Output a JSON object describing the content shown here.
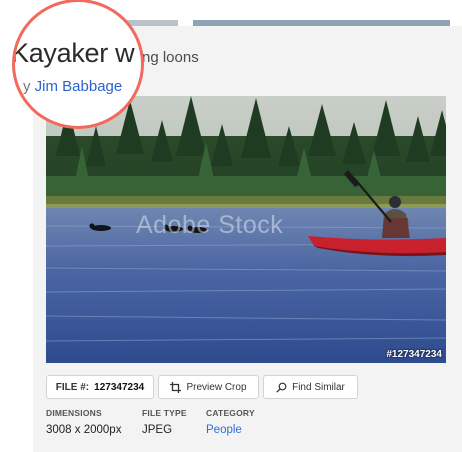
{
  "asset": {
    "title_zoomed": "Kayaker w",
    "title_rest": "ng loons",
    "byline_prefix": "y",
    "author": "Jim Babbage",
    "stock_id_overlay": "#127347234",
    "watermark": "Adobe Stock"
  },
  "actions": {
    "file_label": "FILE #:",
    "file_number": "127347234",
    "preview_crop": "Preview Crop",
    "find_similar": "Find Similar"
  },
  "details": {
    "dimensions_label": "DIMENSIONS",
    "dimensions_value": "3008 x 2000px",
    "filetype_label": "FILE TYPE",
    "filetype_value": "JPEG",
    "category_label": "CATEGORY",
    "category_value": "People"
  },
  "colors": {
    "highlight_ring": "#f2695d",
    "link": "#2c63d0",
    "kayak": "#c8202c"
  }
}
